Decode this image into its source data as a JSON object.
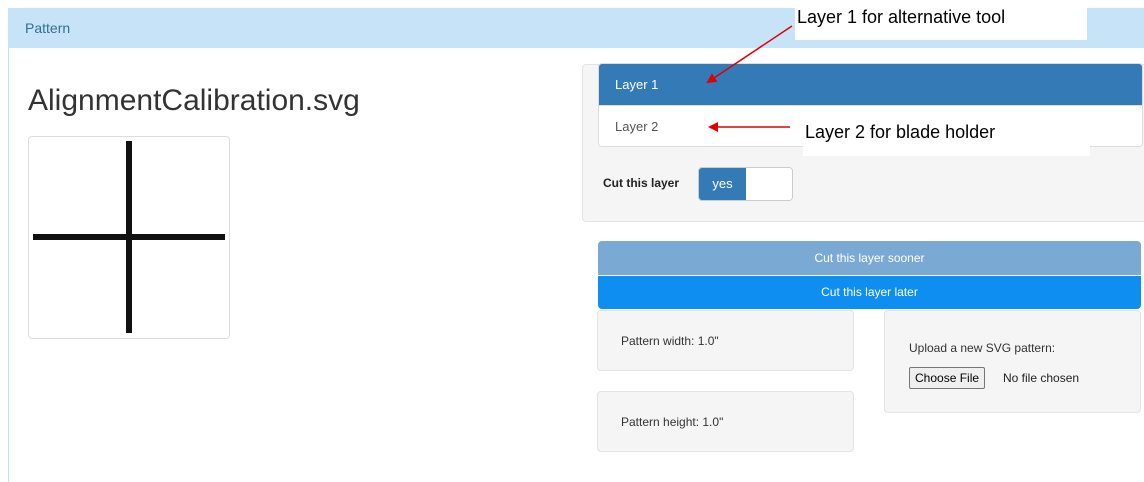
{
  "panel": {
    "heading": "Pattern"
  },
  "file": {
    "title": "AlignmentCalibration.svg"
  },
  "layers": {
    "items": [
      {
        "label": "Layer 1"
      },
      {
        "label": "Layer 2"
      }
    ]
  },
  "cut_toggle": {
    "label": "Cut this layer",
    "on_label": "yes"
  },
  "buttons": {
    "sooner": "Cut this layer sooner",
    "later": "Cut this layer later"
  },
  "pattern": {
    "width": "Pattern width: 1.0\"",
    "height": "Pattern height: 1.0\""
  },
  "upload": {
    "label": "Upload a new SVG pattern:",
    "choose_button": "Choose File",
    "status": "No file chosen"
  },
  "annotations": {
    "layer1": "Layer 1 for alternative tool",
    "layer2": "Layer 2 for blade holder",
    "arrow_color": "#e00000"
  },
  "colors": {
    "heading_bg": "#c7e3f7",
    "active_layer": "#337ab7",
    "sooner_btn": "#7aaad3",
    "later_btn": "#0f8ef2"
  }
}
